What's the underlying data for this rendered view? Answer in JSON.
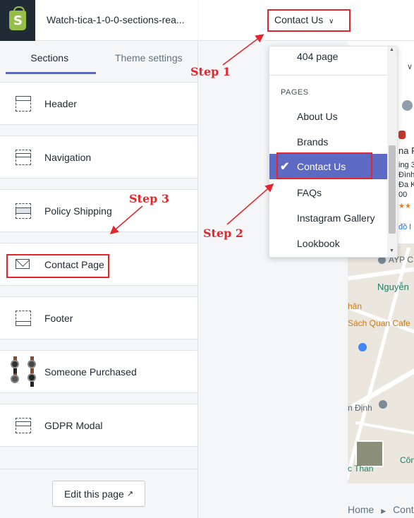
{
  "app": {
    "theme_name": "Watch-tica-1-0-0-sections-rea..."
  },
  "tabs": [
    {
      "label": "Sections"
    },
    {
      "label": "Theme settings"
    }
  ],
  "sections": [
    {
      "label": "Header",
      "icon": "layout-header-icon"
    },
    {
      "label": "Navigation",
      "icon": "layout-navigation-icon"
    },
    {
      "label": "Policy Shipping",
      "icon": "layout-policy-icon"
    },
    {
      "label": "Contact Page",
      "icon": "mail-icon"
    },
    {
      "label": "Footer",
      "icon": "layout-footer-icon"
    },
    {
      "label": "Someone Purchased",
      "icon": "watches-thumbnail"
    },
    {
      "label": "GDPR Modal",
      "icon": "layout-modal-icon"
    }
  ],
  "edit_button": {
    "label": "Edit this page",
    "icon": "external-link-icon"
  },
  "page_selector": {
    "value": "Contact Us"
  },
  "dropdown": {
    "items_before": [
      {
        "label": "404 page"
      }
    ],
    "heading": "PAGES",
    "items": [
      {
        "label": "About Us",
        "selected": false
      },
      {
        "label": "Brands",
        "selected": false
      },
      {
        "label": "Contact Us",
        "selected": true
      },
      {
        "label": "FAQs",
        "selected": false
      },
      {
        "label": "Instagram Gallery",
        "selected": false
      },
      {
        "label": "Lookbook",
        "selected": false
      }
    ]
  },
  "annotations": {
    "step1": "Step 1",
    "step2": "Step 2",
    "step3": "Step 3"
  },
  "preview": {
    "breadcrumb": {
      "home": "Home",
      "current": "Cont"
    },
    "map_labels": [
      "AYP C",
      "Nguyễn",
      "hân",
      "Sách Quan Cafe",
      "n Định",
      "Côn",
      "c Than"
    ],
    "store_partial": [
      "na P",
      "ing 3",
      "Đình",
      "Đa K",
      "00",
      "đồ l"
    ]
  },
  "colors": {
    "accent": "#5c6ac4",
    "annotation": "#e3262b",
    "sidebar_dark": "#212b36"
  }
}
